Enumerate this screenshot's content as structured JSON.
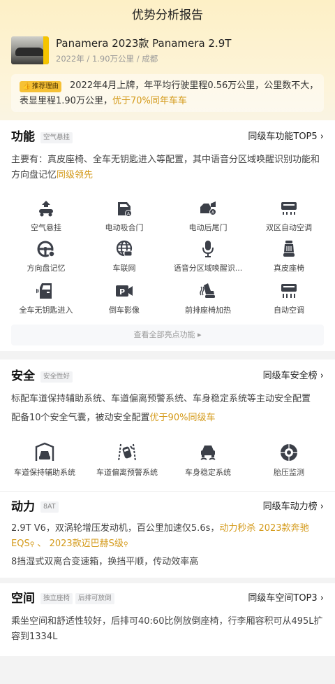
{
  "header": {
    "title": "优势分析报告"
  },
  "car": {
    "name": "Panamera 2023款 Panamera 2.9T",
    "meta": "2022年 / 1.90万公里 / 成都"
  },
  "reason": {
    "tag": "推荐理由",
    "text_a": "2022年4月上牌，年平均行驶里程0.56万公里，公里数不大，表显里程1.90万公里，",
    "text_hl": "优于70%同年车车"
  },
  "function": {
    "title": "功能",
    "badge": "空气悬挂",
    "link": "同级车功能TOP5 ›",
    "desc_a": "主要有：真皮座椅、全车无钥匙进入等配置，其中语音分区域唤醒识别功能和方向盘记忆",
    "desc_hl": "同级领先",
    "items": [
      {
        "label": "空气悬挂",
        "icon": "air-suspension-icon"
      },
      {
        "label": "电动吸合门",
        "icon": "power-door-icon"
      },
      {
        "label": "电动后尾门",
        "icon": "power-tailgate-icon"
      },
      {
        "label": "双区自动空调",
        "icon": "dual-zone-ac-icon"
      },
      {
        "label": "方向盘记忆",
        "icon": "steering-memory-icon"
      },
      {
        "label": "车联网",
        "icon": "connected-car-icon"
      },
      {
        "label": "语音分区域唤醒识...",
        "icon": "voice-wakeup-icon"
      },
      {
        "label": "真皮座椅",
        "icon": "leather-seat-icon"
      },
      {
        "label": "全车无钥匙进入",
        "icon": "keyless-entry-icon"
      },
      {
        "label": "倒车影像",
        "icon": "reverse-camera-icon"
      },
      {
        "label": "前排座椅加热",
        "icon": "seat-heating-icon"
      },
      {
        "label": "自动空调",
        "icon": "auto-ac-icon"
      }
    ],
    "view_all": "查看全部亮点功能 ▸"
  },
  "safety": {
    "title": "安全",
    "badge": "安全性好",
    "link": "同级车安全榜 ›",
    "desc1": "标配车道保持辅助系统、车道偏离预警系统、车身稳定系统等主动安全配置",
    "desc2_a": "配备10个安全气囊，被动安全配置",
    "desc2_hl": "优于90%同级车",
    "items": [
      {
        "label": "车道保持辅助系统",
        "icon": "lane-keep-icon"
      },
      {
        "label": "车道偏离预警系统",
        "icon": "lane-departure-icon"
      },
      {
        "label": "车身稳定系统",
        "icon": "stability-control-icon"
      },
      {
        "label": "胎压监测",
        "icon": "tire-pressure-icon"
      }
    ]
  },
  "power": {
    "title": "动力",
    "badge": "8AT",
    "link": "同级车动力榜 ›",
    "line1_a": "2.9T V6，双涡轮增压发动机，百公里加速仅5.6s，",
    "line1_hl": "动力秒杀 2023款奔驰EQS",
    "line1_sep": " 、 ",
    "line1_hl2": "2023款迈巴赫S级",
    "search_glyph": "⚲",
    "line2": "8挡湿式双离合变速箱，换挡平顺，传动效率高"
  },
  "space": {
    "title": "空间",
    "badge1": "独立座椅",
    "badge2": "后排可放倒",
    "link": "同级车空间TOP3 ›",
    "desc": "乘坐空间和舒适性较好，后排可40:60比例放倒座椅，行李厢容积可从495L扩容到1334L"
  },
  "colors": {
    "accent": "#d49a1a",
    "tag": "#f6c136",
    "icon": "#3b3f48"
  }
}
